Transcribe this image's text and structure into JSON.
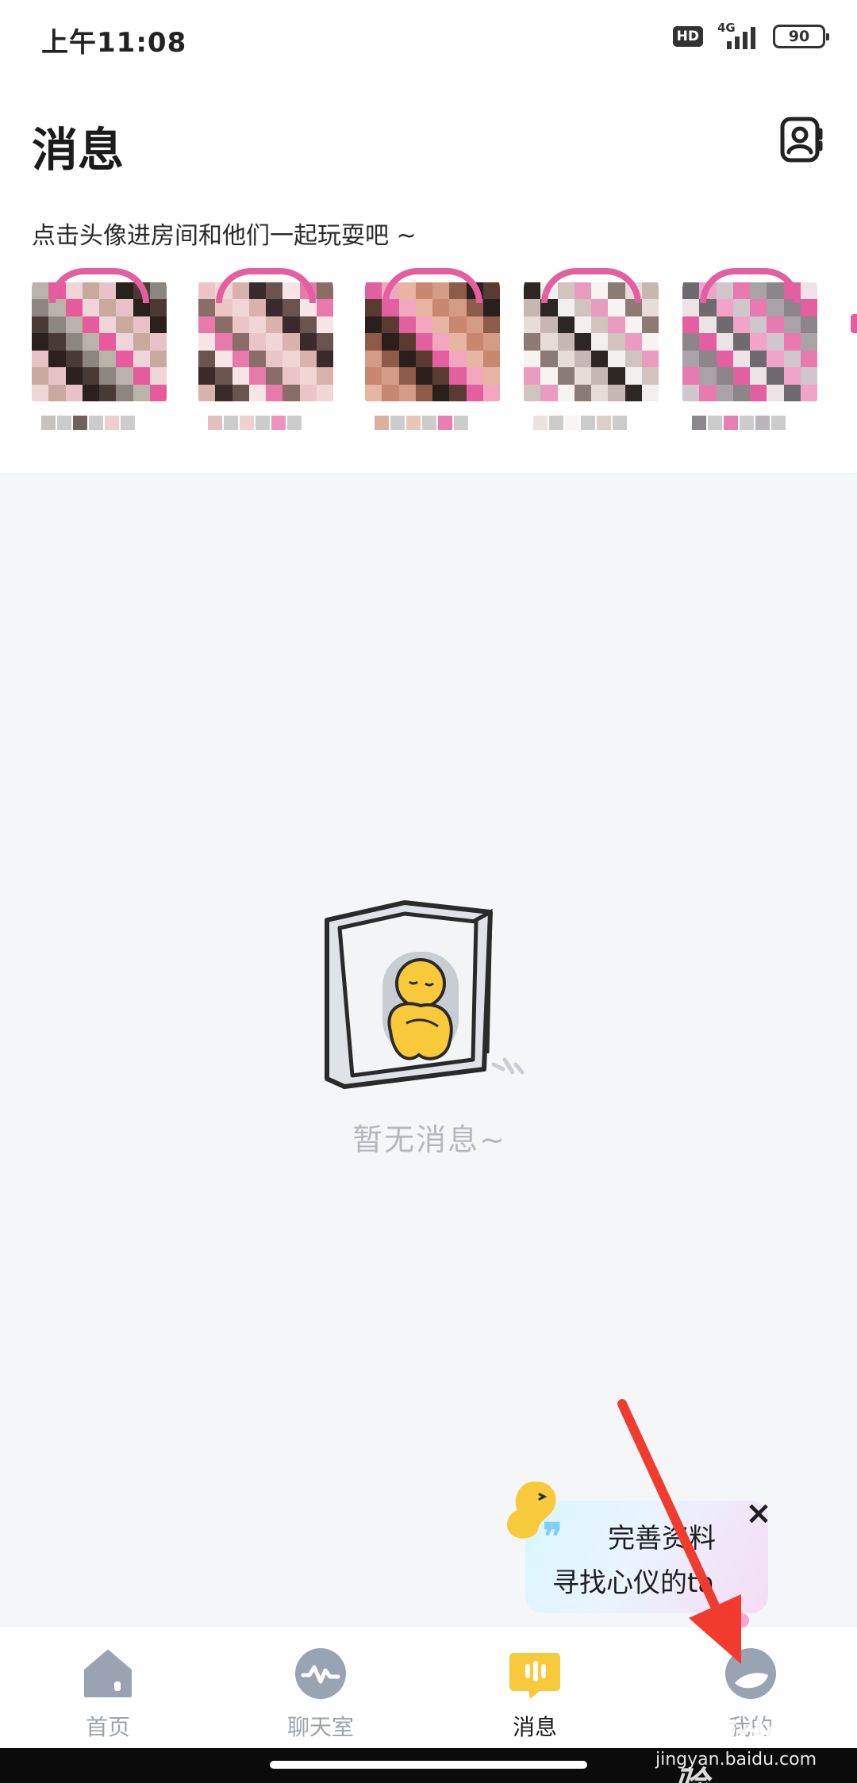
{
  "status_bar": {
    "time": "上午11:08",
    "hd_label": "HD",
    "network_label": "4G",
    "battery_level": "90"
  },
  "header": {
    "title": "消息",
    "contacts_icon": "contacts-icon"
  },
  "recommend": {
    "hint": "点击头像进房间和他们一起玩耍吧 ~",
    "avatars": [
      {
        "ring_color": "#e25fa0",
        "palette": [
          "#b9b3aa",
          "#8c8580",
          "#4a3a36",
          "#2a201d",
          "#e7c3c8",
          "#c9a99d",
          "#f0d5d8",
          "#e75a9b"
        ]
      },
      {
        "ring_color": "#e25fa0",
        "palette": [
          "#3a2a2b",
          "#d9b2ae",
          "#f1d6d6",
          "#ebc5c6",
          "#8a6c68",
          "#e879ab",
          "#f7e4e6",
          "#6b5350"
        ]
      },
      {
        "ring_color": "#e25fa0",
        "palette": [
          "#2b1f1c",
          "#8e5b4a",
          "#d49c86",
          "#c98670",
          "#e6b6a2",
          "#f0a7bf",
          "#e25fa0",
          "#5a3b31"
        ]
      },
      {
        "ring_color": "#e25fa0",
        "palette": [
          "#f2f0ee",
          "#2c2624",
          "#c7b7b2",
          "#e6dcd8",
          "#8c7a75",
          "#f7f3f1",
          "#ea9cc0",
          "#d1c3be"
        ]
      },
      {
        "ring_color": "#e25fa0",
        "palette": [
          "#a9a3a8",
          "#e87ab0",
          "#cfc7cc",
          "#f2a3c8",
          "#6f6a70",
          "#ece3e7",
          "#e25fa0",
          "#8c8589"
        ]
      }
    ]
  },
  "empty_state": {
    "text": "暂无消息~"
  },
  "promo": {
    "line1": "完善资料",
    "line2": "寻找心仪的ta",
    "close_glyph": "×"
  },
  "tabs": [
    {
      "label": "首页",
      "icon": "home-icon",
      "active": false
    },
    {
      "label": "聊天室",
      "icon": "waveform-icon",
      "active": false
    },
    {
      "label": "消息",
      "icon": "message-icon",
      "active": true
    },
    {
      "label": "我的",
      "icon": "profile-icon",
      "active": false
    }
  ],
  "watermark": {
    "brand": "Baidu经验",
    "url": "jingyan.baidu.com"
  },
  "colors": {
    "accent_yellow": "#f7c93b",
    "avatar_ring": "#e25fa0",
    "annotation_red": "#f03b2e"
  }
}
